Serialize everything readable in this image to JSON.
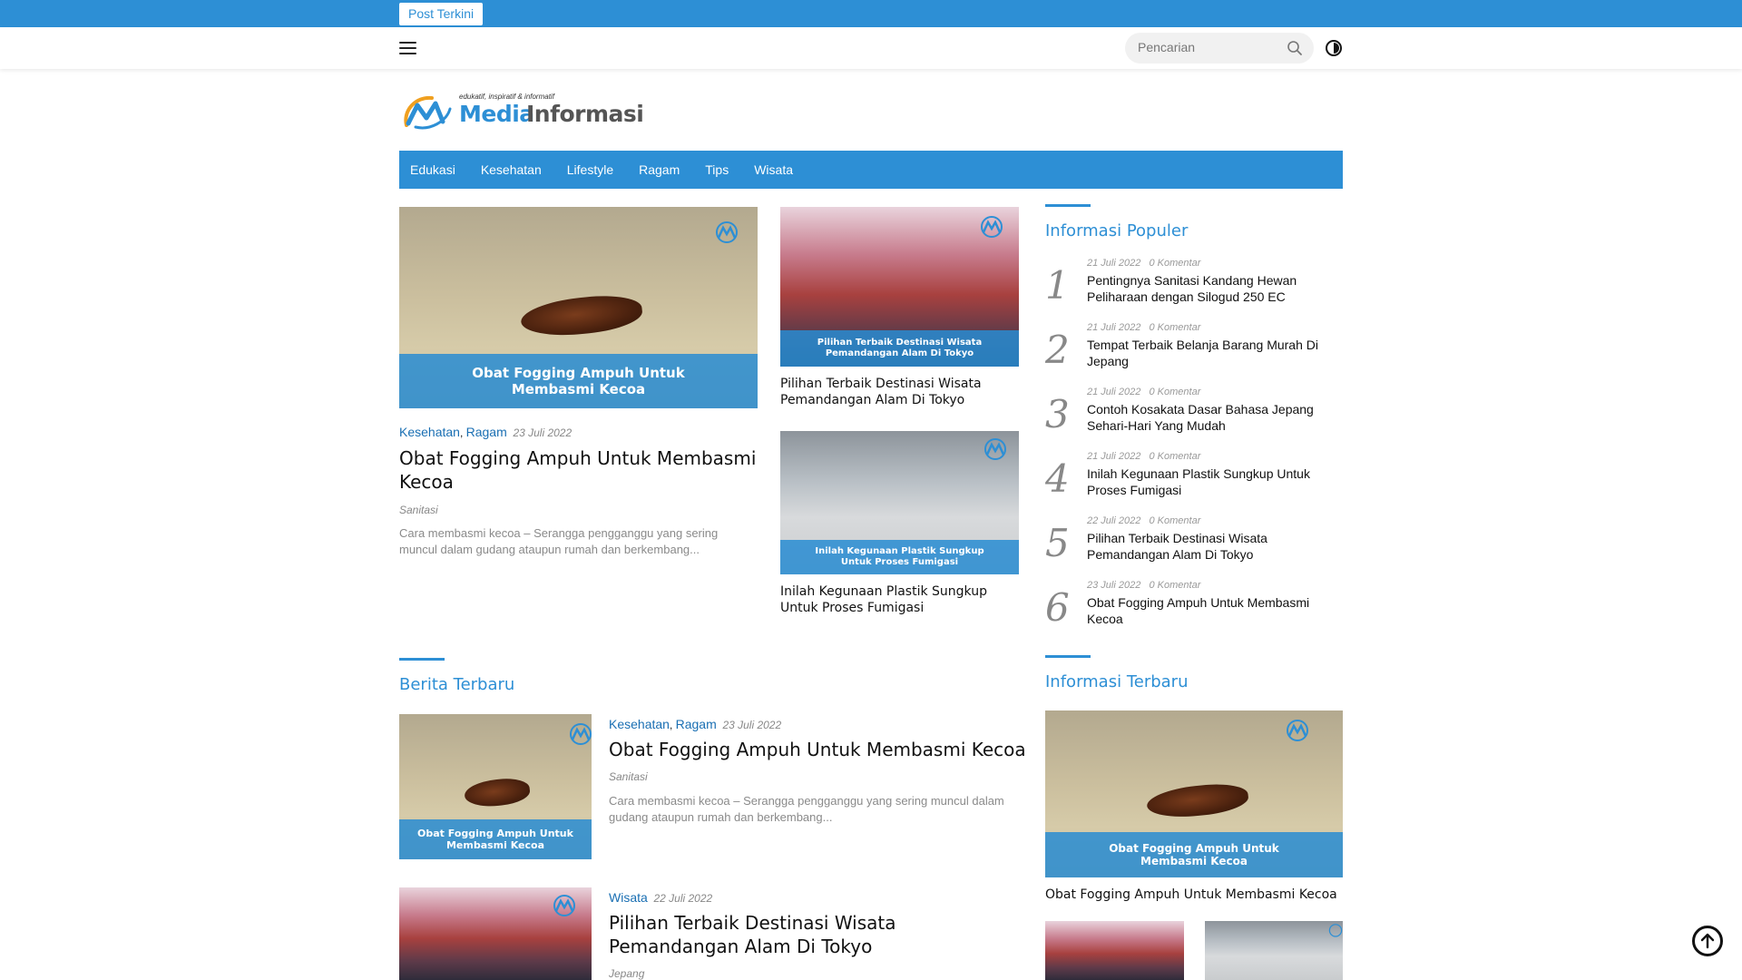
{
  "topbar": {
    "badge": "Post Terkini"
  },
  "header": {
    "search_placeholder": "Pencarian"
  },
  "logo": {
    "tagline": "edukatif, inspiratif & informatif",
    "word1": "Media",
    "word2": "Informasi"
  },
  "nav": {
    "items": [
      "Edukasi",
      "Kesehatan",
      "Lifestyle",
      "Ragam",
      "Tips",
      "Wisata"
    ]
  },
  "featured": {
    "main": {
      "image_banner": [
        "Obat Fogging Ampuh Untuk",
        "Membasmi Kecoa"
      ],
      "cat1": "Kesehatan",
      "cat2": "Ragam",
      "date": "23 Juli 2022",
      "title": "Obat Fogging Ampuh Untuk Membasmi Kecoa",
      "tag": "Sanitasi",
      "excerpt": "Cara membasmi kecoa – Serangga pengganggu yang sering muncul dalam gudang ataupun rumah dan berkembang..."
    },
    "side": [
      {
        "image_banner": [
          "Pilihan Terbaik Destinasi Wisata",
          "Pemandangan Alam Di Tokyo"
        ],
        "title": "Pilihan Terbaik Destinasi Wisata Pemandangan Alam Di Tokyo"
      },
      {
        "image_banner": [
          "Inilah Kegunaan Plastik Sungkup",
          "Untuk Proses Fumigasi"
        ],
        "title": "Inilah Kegunaan Plastik Sungkup Untuk Proses Fumigasi"
      }
    ]
  },
  "populer": {
    "heading": "Informasi Populer",
    "items": [
      {
        "num": "1",
        "date": "21 Juli 2022",
        "comments": "0 Komentar",
        "title": "Pentingnya Sanitasi Kandang Hewan Peliharaan dengan Silogud 250 EC"
      },
      {
        "num": "2",
        "date": "21 Juli 2022",
        "comments": "0 Komentar",
        "title": "Tempat Terbaik Belanja Barang Murah Di Jepang"
      },
      {
        "num": "3",
        "date": "21 Juli 2022",
        "comments": "0 Komentar",
        "title": "Contoh Kosakata Dasar Bahasa Jepang Sehari-Hari Yang Mudah"
      },
      {
        "num": "4",
        "date": "21 Juli 2022",
        "comments": "0 Komentar",
        "title": "Inilah Kegunaan Plastik Sungkup Untuk Proses Fumigasi"
      },
      {
        "num": "5",
        "date": "22 Juli 2022",
        "comments": "0 Komentar",
        "title": "Pilihan Terbaik Destinasi Wisata Pemandangan Alam Di Tokyo"
      },
      {
        "num": "6",
        "date": "23 Juli 2022",
        "comments": "0 Komentar",
        "title": "Obat Fogging Ampuh Untuk Membasmi Kecoa"
      }
    ]
  },
  "berita": {
    "heading": "Berita Terbaru",
    "items": [
      {
        "image_banner": [
          "Obat Fogging Ampuh Untuk",
          "Membasmi Kecoa"
        ],
        "cat1": "Kesehatan",
        "cat2": "Ragam",
        "date": "23 Juli 2022",
        "title": "Obat Fogging Ampuh Untuk Membasmi Kecoa",
        "tag": "Sanitasi",
        "excerpt": "Cara membasmi kecoa – Serangga pengganggu yang sering muncul dalam gudang ataupun rumah dan berkembang..."
      },
      {
        "cat1": "Wisata",
        "date": "22 Juli 2022",
        "title": "Pilihan Terbaik Destinasi Wisata Pemandangan Alam Di Tokyo",
        "tag": "Jepang"
      }
    ]
  },
  "terbaru": {
    "heading": "Informasi Terbaru",
    "main": {
      "image_banner": [
        "Obat Fogging Ampuh Untuk",
        "Membasmi Kecoa"
      ],
      "title": "Obat Fogging Ampuh Untuk Membasmi Kecoa"
    }
  },
  "watermark": {
    "brand": "Media Informasi"
  },
  "colors": {
    "accent": "#2d8fd5",
    "category": "#1a6fb3"
  }
}
